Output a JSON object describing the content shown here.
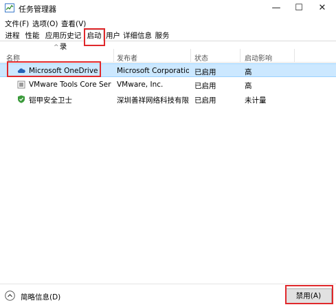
{
  "window": {
    "title": "任务管理器",
    "minimize_glyph": "—",
    "maximize_glyph": "☐",
    "close_glyph": "✕"
  },
  "menu": [
    "文件(F)",
    "选项(O)",
    "查看(V)"
  ],
  "tabs": [
    {
      "label": "进程",
      "active": false
    },
    {
      "label": "性能",
      "active": false
    },
    {
      "label": "应用历史记录",
      "active": false
    },
    {
      "label": "启动",
      "active": true
    },
    {
      "label": "用户",
      "active": false
    },
    {
      "label": "详细信息",
      "active": false
    },
    {
      "label": "服务",
      "active": false
    }
  ],
  "table": {
    "sort_glyph": "^",
    "columns": [
      "名称",
      "发布者",
      "状态",
      "启动影响"
    ],
    "rows": [
      {
        "name": "Microsoft OneDrive",
        "publisher": "Microsoft Corporation",
        "status": "已启用",
        "impact": "高",
        "icon": "onedrive-icon",
        "selected": true
      },
      {
        "name": "VMware Tools Core Servi...",
        "publisher": "VMware, Inc.",
        "status": "已启用",
        "impact": "高",
        "icon": "vmware-icon",
        "selected": false
      },
      {
        "name": "铠甲安全卫士",
        "publisher": "深圳善祥网络科技有限...",
        "status": "已启用",
        "impact": "未计量",
        "icon": "shield-icon",
        "selected": false
      }
    ]
  },
  "footer": {
    "collapse_label": "简略信息(D)",
    "disable_label": "禁用(A)"
  },
  "colors": {
    "highlight": "#e0282b",
    "selection": "#cce8ff",
    "onedrive": "#2563b8",
    "shield": "#3a9a3a"
  }
}
